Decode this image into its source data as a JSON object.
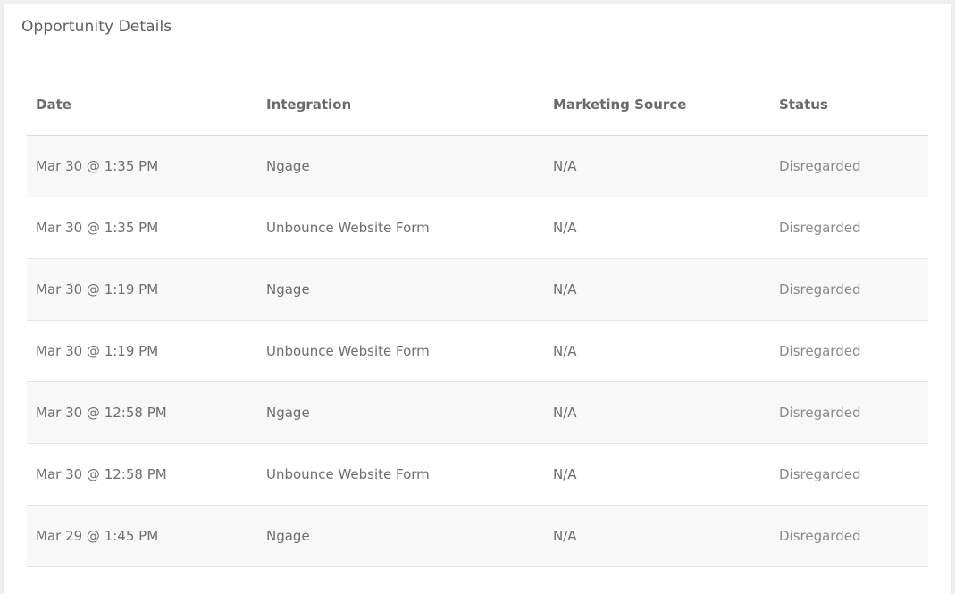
{
  "card": {
    "title": "Opportunity Details"
  },
  "table": {
    "headers": {
      "date": "Date",
      "integration": "Integration",
      "marketing_source": "Marketing Source",
      "status": "Status"
    },
    "rows": [
      {
        "date": "Mar 30 @ 1:35 PM",
        "integration": "Ngage",
        "marketing_source": "N/A",
        "status": "Disregarded"
      },
      {
        "date": "Mar 30 @ 1:35 PM",
        "integration": "Unbounce Website Form",
        "marketing_source": "N/A",
        "status": "Disregarded"
      },
      {
        "date": "Mar 30 @ 1:19 PM",
        "integration": "Ngage",
        "marketing_source": "N/A",
        "status": "Disregarded"
      },
      {
        "date": "Mar 30 @ 1:19 PM",
        "integration": "Unbounce Website Form",
        "marketing_source": "N/A",
        "status": "Disregarded"
      },
      {
        "date": "Mar 30 @ 12:58 PM",
        "integration": "Ngage",
        "marketing_source": "N/A",
        "status": "Disregarded"
      },
      {
        "date": "Mar 30 @ 12:58 PM",
        "integration": "Unbounce Website Form",
        "marketing_source": "N/A",
        "status": "Disregarded"
      },
      {
        "date": "Mar 29 @ 1:45 PM",
        "integration": "Ngage",
        "marketing_source": "N/A",
        "status": "Disregarded"
      }
    ]
  },
  "colors": {
    "page_background": "#f0f0f0",
    "card_background": "#ffffff",
    "stripe_background": "#f8f8f8",
    "text": "#6e6e6e",
    "status_text": "#8a8a8a"
  }
}
